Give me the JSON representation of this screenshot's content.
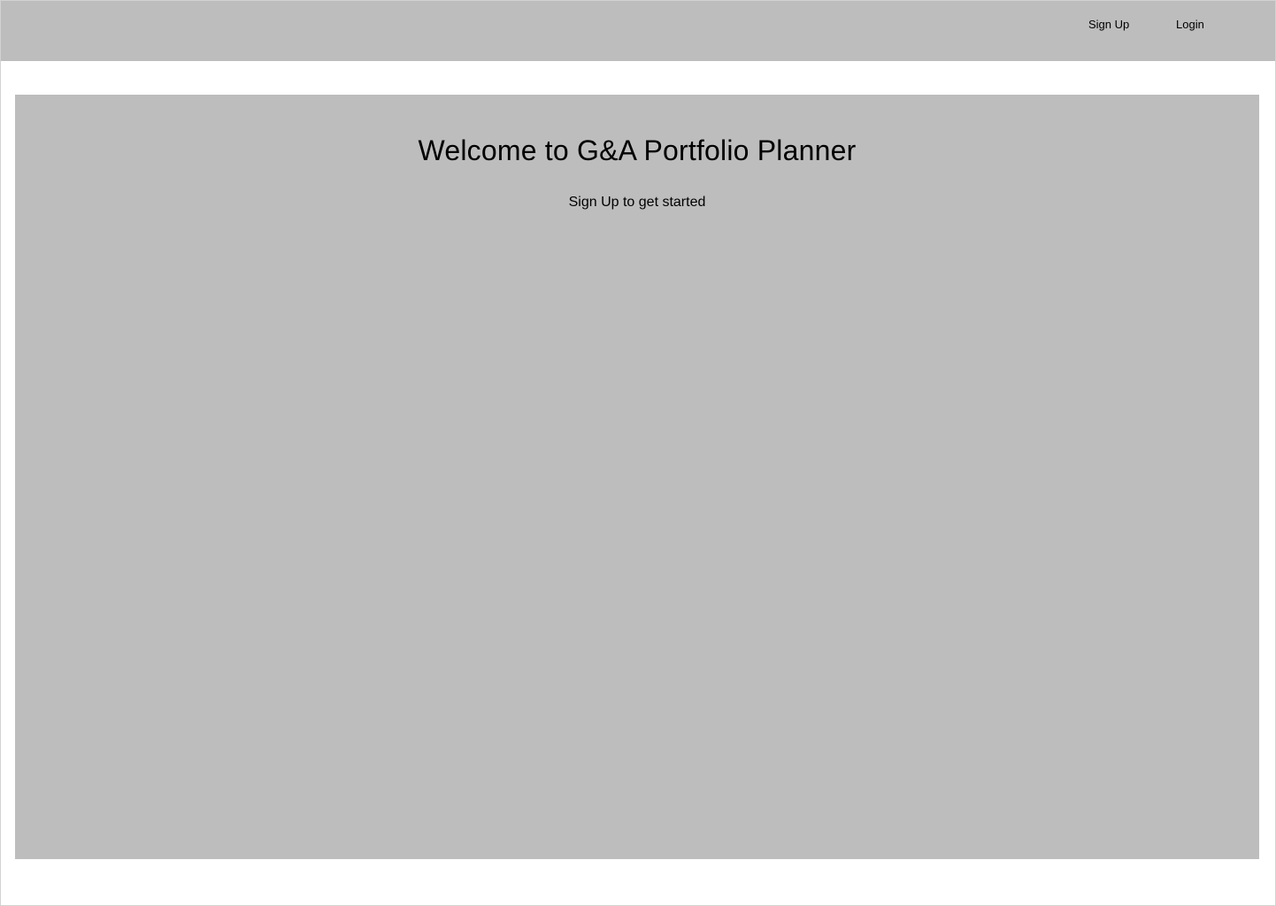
{
  "header": {
    "nav": {
      "signup_label": "Sign Up",
      "login_label": "Login"
    }
  },
  "hero": {
    "title": "Welcome to G&A Portfolio Planner",
    "subtitle": "Sign Up to get started"
  },
  "colors": {
    "panel_gray": "#bdbdbd",
    "background": "#ffffff",
    "text": "#000000",
    "frame_border": "#d2d2d2"
  }
}
